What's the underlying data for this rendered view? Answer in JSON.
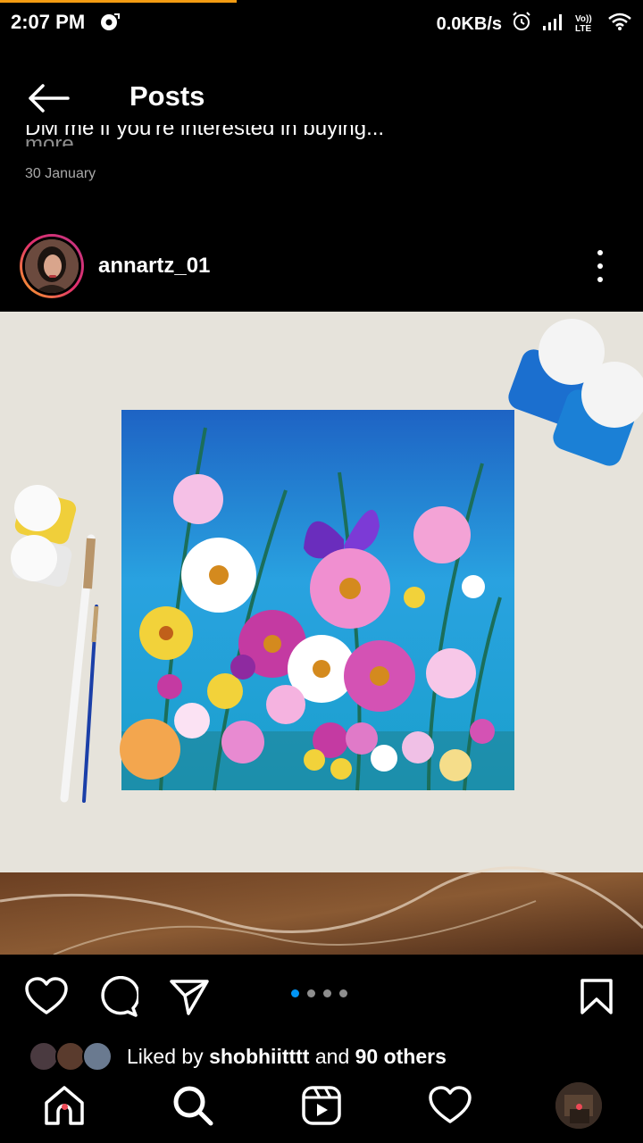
{
  "status_bar": {
    "time": "2:07 PM",
    "network_speed": "0.0KB/s",
    "lte_label": "Vo)) LTE",
    "icons": [
      "notification-icon",
      "alarm-icon",
      "signal-icon",
      "wifi-icon"
    ]
  },
  "header": {
    "title": "Posts",
    "back_icon": "back-arrow-icon"
  },
  "previous_post": {
    "caption": "DM me if you're interested in buying...",
    "more_label": " more",
    "date": "30 January"
  },
  "post": {
    "username": "annartz_01",
    "more_icon": "more-vertical-icon",
    "image_description": "acrylic-floral-painting",
    "carousel": {
      "count": 4,
      "active_index": 0
    },
    "likes": {
      "prefix": "Liked by ",
      "user": "shobhiitttt",
      "middle": " and ",
      "others": "90 others"
    }
  },
  "actions": {
    "like_icon": "heart-icon",
    "comment_icon": "comment-icon",
    "share_icon": "share-icon",
    "save_icon": "bookmark-icon"
  },
  "bottom_nav": {
    "items": [
      "home-icon",
      "search-icon",
      "reels-icon",
      "activity-icon",
      "profile-avatar"
    ]
  },
  "colors": {
    "background": "#000000",
    "accent_blue": "#0095f6",
    "notification_red": "#ed4956",
    "secondary_text": "#a8a8a8"
  }
}
